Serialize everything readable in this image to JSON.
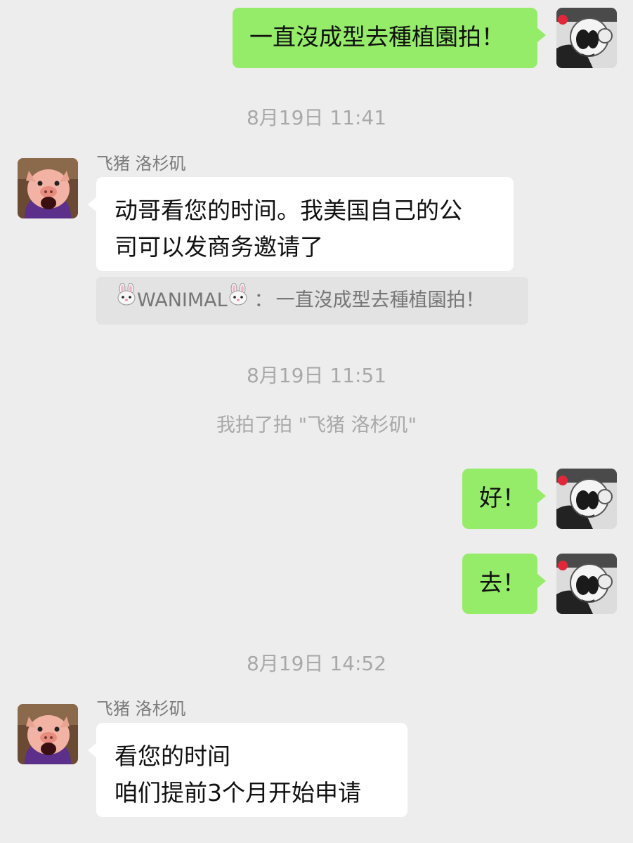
{
  "messages": {
    "out1": "一直沒成型去種植園拍！",
    "ts1": "8月19日 11:41",
    "in1_sender": "飞猪 洛杉矶",
    "in1_text": "动哥看您的时间。我美国自己的公\n司可以发商务邀请了",
    "quote_name": "WANIMAL",
    "quote_text": "一直沒成型去種植園拍！",
    "ts2": "8月19日 11:51",
    "pat": "我拍了拍 \"飞猪 洛杉矶\"",
    "out2": "好！",
    "out3": "去！",
    "ts3": "8月19日 14:52",
    "in2_sender": "飞猪 洛杉矶",
    "in2_text": "看您的时间\n咱们提前3个月开始申请"
  },
  "icons": {
    "self_avatar": "monkey-avatar-icon",
    "contact_avatar": "pig-avatar-icon",
    "quote_emoji": "rabbit-face-icon"
  },
  "colors": {
    "background": "#ededed",
    "outgoing_bubble": "#95ec69",
    "incoming_bubble": "#ffffff",
    "quote_background": "#e3e3e3",
    "meta_text": "#a8a8a8"
  }
}
